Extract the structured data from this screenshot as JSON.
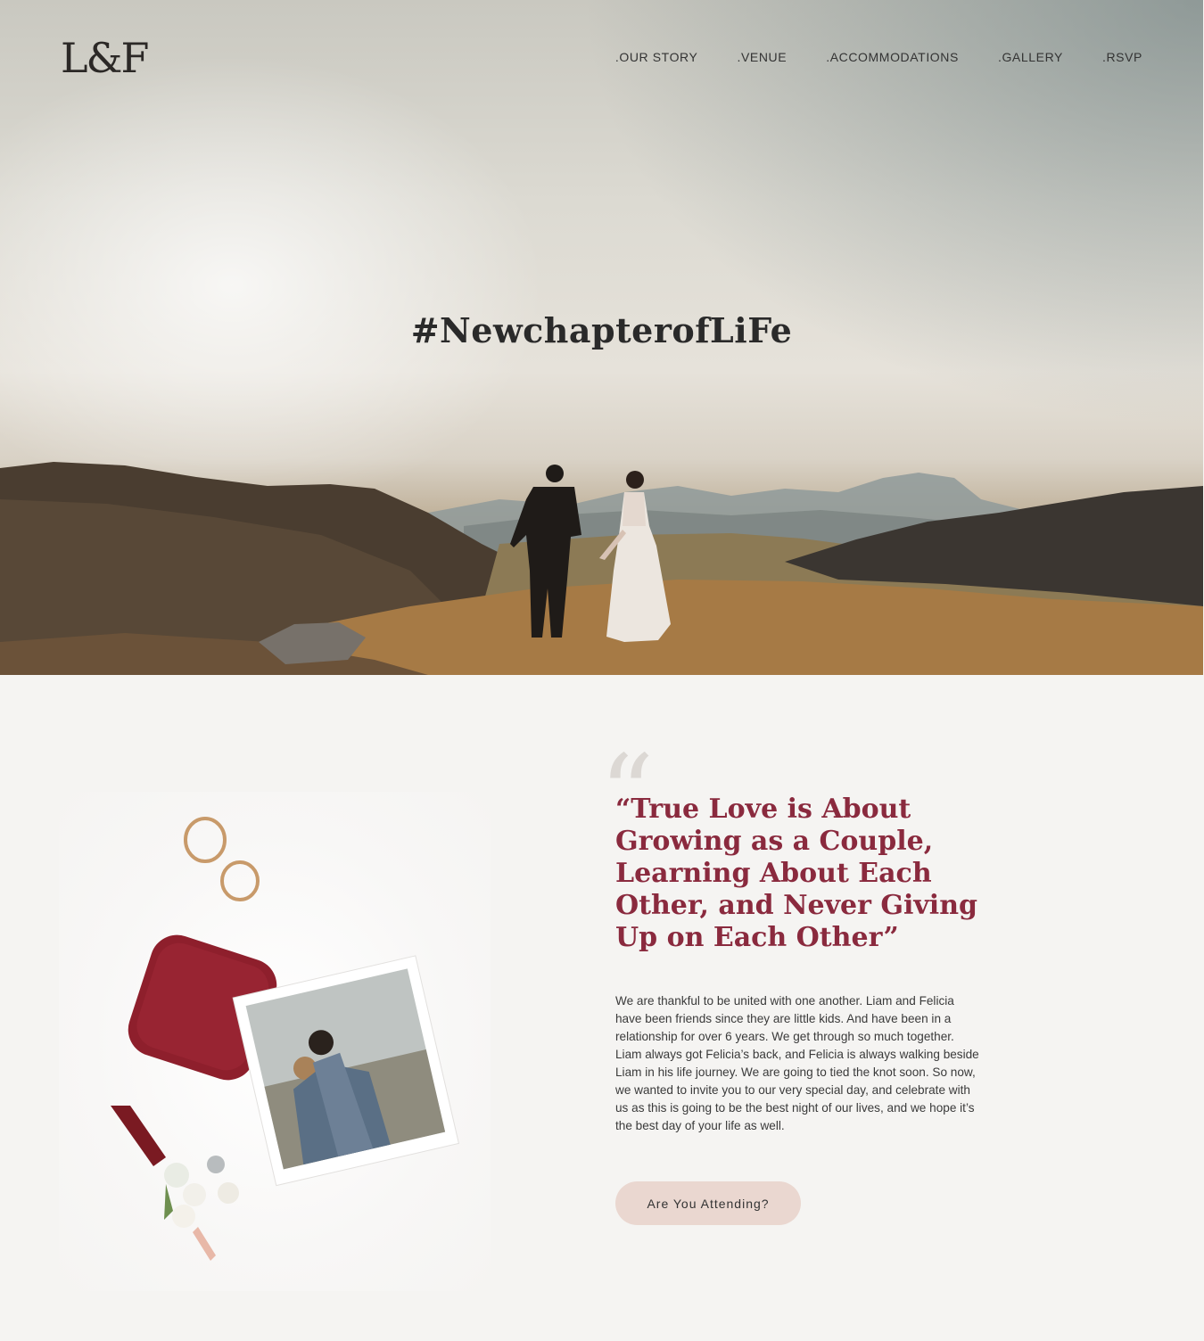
{
  "header": {
    "logo": "L&F",
    "nav": [
      {
        "label": ".OUR STORY"
      },
      {
        "label": ".VENUE"
      },
      {
        "label": ".ACCOMMODATIONS"
      },
      {
        "label": ".GALLERY"
      },
      {
        "label": ".RSVP"
      }
    ]
  },
  "hero": {
    "hashtag": "#NewchapterofLiFe"
  },
  "story": {
    "quote_mark": "“",
    "quote": "“True Love is About Growing as a Couple, Learning About Each Other, and Never Giving Up on Each Other”",
    "body": "We are thankful to be united with one another. Liam and Felicia have been friends since they are little kids. And have been in a relationship for over 6 years. We get through so much together. Liam always got Felicia’s back, and Felicia is always walking beside Liam in his life journey. We are going to tied the knot soon. So now, we wanted to invite you to our very special day, and celebrate with us as this is going to be the best night of our lives, and we hope it’s the best day of your life as well.",
    "cta_label": "Are You Attending?"
  },
  "colors": {
    "accent": "#8a2a3e",
    "button_bg": "#ead7d0",
    "page_bg": "#f5f4f2"
  }
}
